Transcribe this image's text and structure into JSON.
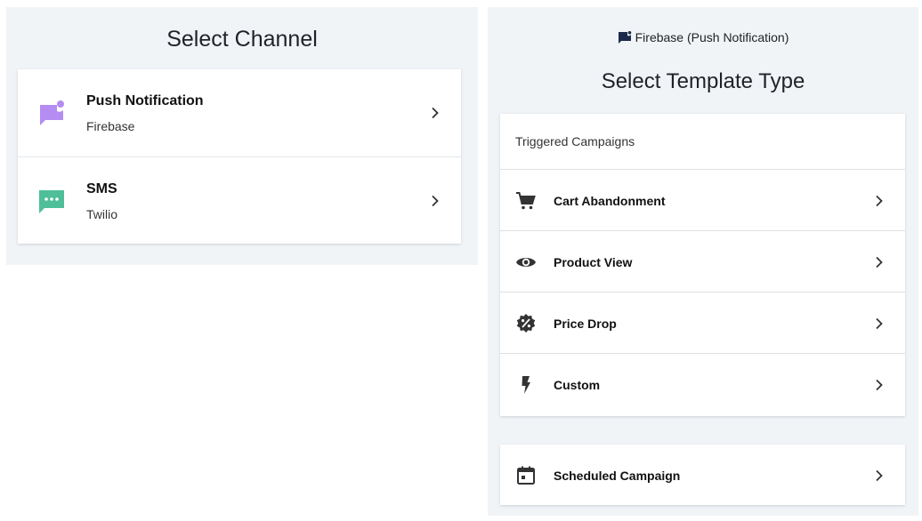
{
  "channel_panel": {
    "title": "Select Channel",
    "channels": [
      {
        "name": "Push Notification",
        "provider": "Firebase",
        "icon": "push-notification-icon",
        "color": "#b48cf2"
      },
      {
        "name": "SMS",
        "provider": "Twilio",
        "icon": "sms-icon",
        "color": "#4fbf9a"
      }
    ]
  },
  "template_panel": {
    "provider_label": "Firebase (Push Notification)",
    "provider_icon": "flag-notification-icon",
    "title": "Select Template Type",
    "triggered_section": {
      "header": "Triggered Campaigns",
      "items": [
        {
          "label": "Cart Abandonment",
          "icon": "cart-icon"
        },
        {
          "label": "Product View",
          "icon": "eye-icon"
        },
        {
          "label": "Price Drop",
          "icon": "discount-badge-icon"
        },
        {
          "label": "Custom",
          "icon": "lightning-icon"
        }
      ]
    },
    "scheduled_item": {
      "label": "Scheduled Campaign",
      "icon": "calendar-icon"
    }
  }
}
